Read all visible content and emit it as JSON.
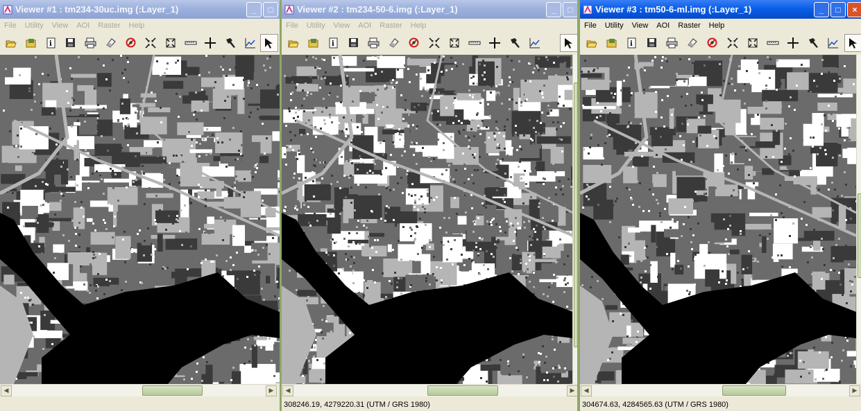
{
  "viewers": [
    {
      "title": "Viewer #1 : tm234-30uc.img (:Layer_1)",
      "menu": [
        "File",
        "Utility",
        "View",
        "AOI",
        "Raster",
        "Help"
      ],
      "status": ""
    },
    {
      "title": "Viewer #2 : tm234-50-6.img (:Layer_1)",
      "menu": [
        "File",
        "Utility",
        "View",
        "AOI",
        "Raster",
        "Help"
      ],
      "status": "308246.19, 4279220.31  (UTM / GRS 1980)"
    },
    {
      "title": "Viewer #3 : tm50-6-ml.img (:Layer_1)",
      "menu": [
        "File",
        "Utility",
        "View",
        "AOI",
        "Raster",
        "Help"
      ],
      "status": "304674.63, 4284565.63  (UTM / GRS 1980)"
    }
  ],
  "toolbar_icons": [
    "open-icon",
    "open-raster-icon",
    "info-icon",
    "save-icon",
    "print-icon",
    "eraser-icon",
    "clear-icon",
    "zoom-in-icon",
    "zoom-out-icon",
    "measure-icon",
    "crosshair-icon",
    "hammer-icon",
    "profile-icon",
    "pointer-icon"
  ],
  "window_buttons": {
    "minimize": "_",
    "maximize": "□",
    "close": "×"
  },
  "colors": {
    "inactive_title": "#9db1de",
    "active_title": "#0a5fe8",
    "scroll_thumb": "#b7c99a",
    "class_water": "#000000",
    "class_1": "#3a3a3a",
    "class_2": "#6b6b6b",
    "class_3": "#b5b5b5",
    "class_4": "#ffffff"
  }
}
